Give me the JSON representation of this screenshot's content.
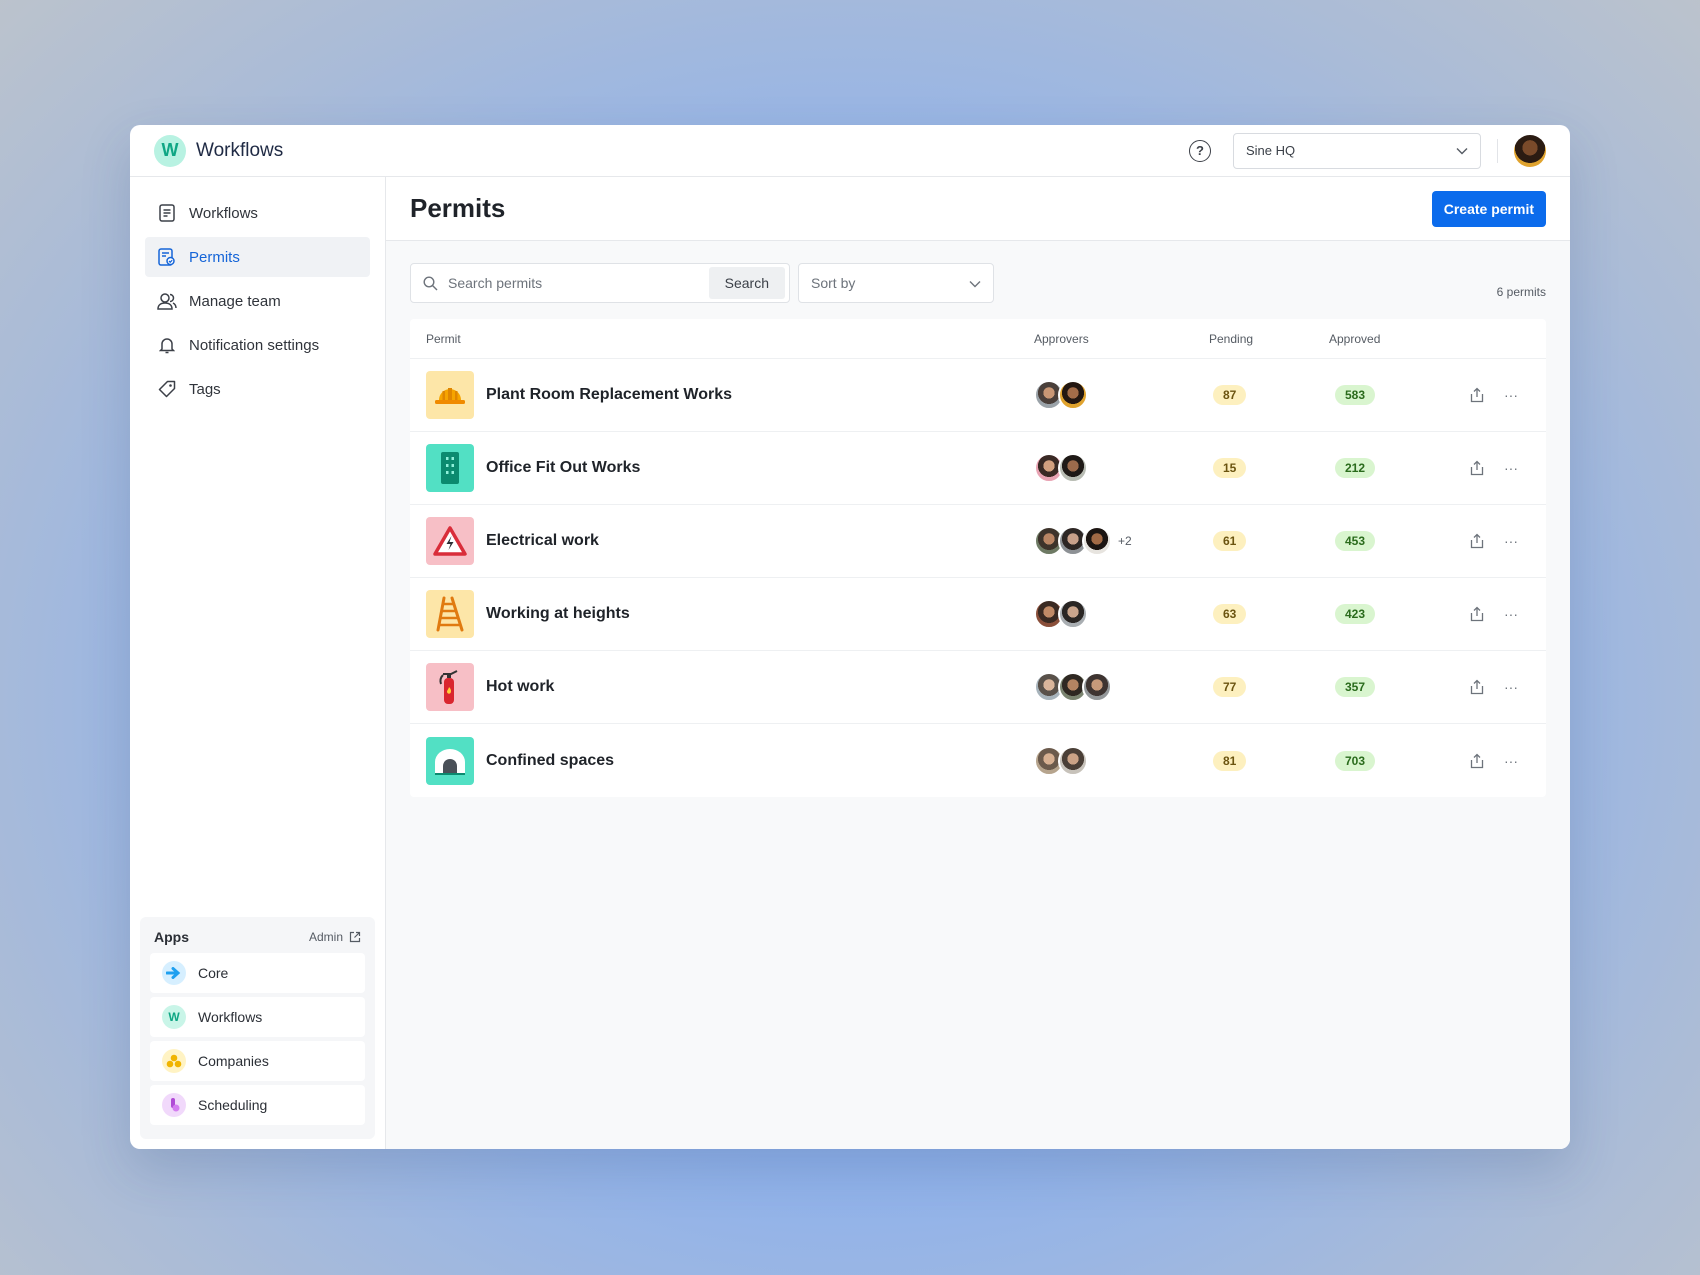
{
  "brand": {
    "name": "Workflows",
    "logo_letter": "W"
  },
  "topbar": {
    "org": "Sine HQ"
  },
  "sidebar": {
    "items": [
      {
        "label": "Workflows",
        "icon": "document-icon"
      },
      {
        "label": "Permits",
        "icon": "permit-icon",
        "active": true
      },
      {
        "label": "Manage team",
        "icon": "team-icon"
      },
      {
        "label": "Notification settings",
        "icon": "bell-icon"
      },
      {
        "label": "Tags",
        "icon": "tag-icon"
      }
    ],
    "apps": {
      "title": "Apps",
      "admin_label": "Admin",
      "items": [
        {
          "label": "Core",
          "icon": "core-app-icon",
          "color": "#1ea0f0"
        },
        {
          "label": "Workflows",
          "icon": "workflows-app-icon",
          "color": "#0fa684"
        },
        {
          "label": "Companies",
          "icon": "companies-app-icon",
          "color": "#f0b400"
        },
        {
          "label": "Scheduling",
          "icon": "scheduling-app-icon",
          "color": "#b04ad6"
        }
      ]
    }
  },
  "main": {
    "title": "Permits",
    "create_label": "Create permit",
    "search": {
      "placeholder": "Search permits",
      "button": "Search"
    },
    "sort": {
      "placeholder": "Sort by"
    },
    "count": "6 permits",
    "columns": {
      "permit": "Permit",
      "approvers": "Approvers",
      "pending": "Pending",
      "approved": "Approved"
    },
    "rows": [
      {
        "name": "Plant Room Replacement Works",
        "icon": "hard-hat-icon",
        "pending": "87",
        "approved": "583",
        "more": ""
      },
      {
        "name": "Office Fit Out Works",
        "icon": "building-icon",
        "pending": "15",
        "approved": "212",
        "more": ""
      },
      {
        "name": "Electrical work",
        "icon": "electrical-warning-icon",
        "pending": "61",
        "approved": "453",
        "more": "+2"
      },
      {
        "name": "Working at heights",
        "icon": "ladder-icon",
        "pending": "63",
        "approved": "423",
        "more": ""
      },
      {
        "name": "Hot work",
        "icon": "fire-extinguisher-icon",
        "pending": "77",
        "approved": "357",
        "more": ""
      },
      {
        "name": "Confined spaces",
        "icon": "tunnel-icon",
        "pending": "81",
        "approved": "703",
        "more": ""
      }
    ]
  },
  "colors": {
    "accent": "#0b6bec",
    "pending_pill": "#fdf0bf",
    "approved_pill": "#d9f5cf"
  }
}
